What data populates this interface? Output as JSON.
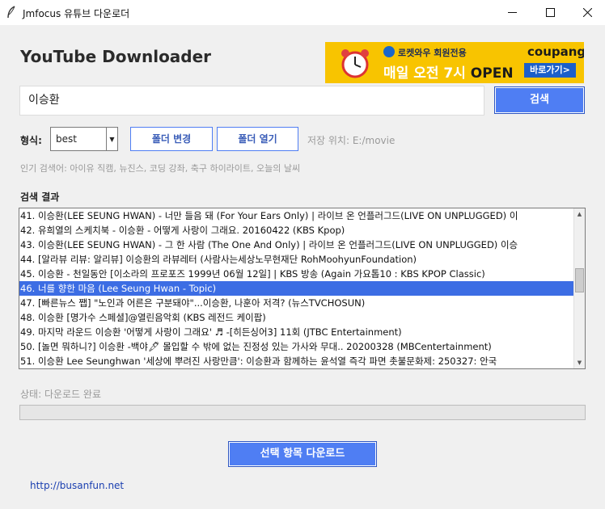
{
  "window": {
    "title": "Jmfocus 유튜브 다운로더"
  },
  "app": {
    "heading": "YouTube Downloader"
  },
  "ad": {
    "top_text": "로켓와우 회원전용",
    "main_text": "매일 오전 7시",
    "open_text": "OPEN",
    "brand": "coupang",
    "cta": "바로가기>"
  },
  "search": {
    "value": "이승환",
    "button": "검색"
  },
  "format": {
    "label": "형식:",
    "selected": "best"
  },
  "buttons": {
    "folder_change": "폴더 변경",
    "folder_open": "폴더 열기",
    "download": "선택 항목 다운로드"
  },
  "save_path": "저장 위치: E:/movie",
  "popular": "인기 검색어: 아이유 직캠, 뉴진스, 코딩 강좌, 축구 하이라이트, 오늘의 날씨",
  "results": {
    "label": "검색 결과",
    "items": [
      "41. 이승환(LEE SEUNG HWAN) - 너만 들음 돼 (For Your Ears Only) | 라이브 온 언플러그드(LIVE ON UNPLUGGED) 이",
      "42. 유희열의 스케치북 - 이승환 - 어떻게 사랑이 그래요. 20160422 (KBS Kpop)",
      "43. 이승환(LEE SEUNG HWAN) - 그 한 사람 (The One And Only) | 라이브 온 언플러그드(LIVE ON UNPLUGGED) 이승",
      "44. [알라뷰 리뷰: 알리뷰] 이승환의 라뷰레터 (사람사는세상노무현재단 RohMoohyunFoundation)",
      "45. 이승환 - 천일동안 [이소라의 프로포즈 1999년 06월 12일] | KBS 방송 (Again 가요톱10 : KBS KPOP Classic)",
      "46. 너를 향한 마음 (Lee Seung Hwan - Topic)",
      "47. [빠른뉴스 쨉] \"노인과 어른은 구분돼야\"...이승환, 나훈아 저격? (뉴스TVCHOSUN)",
      "48. 이승환  [명가수 스페셜]@열린음악회 (KBS 레전드 케이팝)",
      "49. 마지막 라운드 이승환 '어떻게 사랑이 그래요' ♬ -[히든싱어3] 11회 (JTBC Entertainment)",
      "50. [놀면 뭐하니?] 이승환 -백야🖋 몰입할 수 밖에 없는 진정성 있는 가사와 무대.. 20200328 (MBCentertainment)",
      "51. 이승환 Lee Seunghwan '세상에 뿌려진 사랑만큼': 이승환과 함께하는 윤석열 즉각 파면 촛불문화제: 250327: 안국"
    ],
    "selected_index": 5
  },
  "status": "상태: 다운로드 완료",
  "progress": {
    "percent": 0
  },
  "footer": {
    "link": "http://busanfun.net"
  },
  "colors": {
    "accent": "#4f7ef3",
    "selection": "#3c6de4",
    "ad_bg": "#f8c400",
    "muted_text": "#9a9a9a"
  },
  "icons": {
    "app": "feather-icon",
    "minimize": "minimize-icon",
    "maximize": "maximize-icon",
    "close": "close-icon"
  }
}
